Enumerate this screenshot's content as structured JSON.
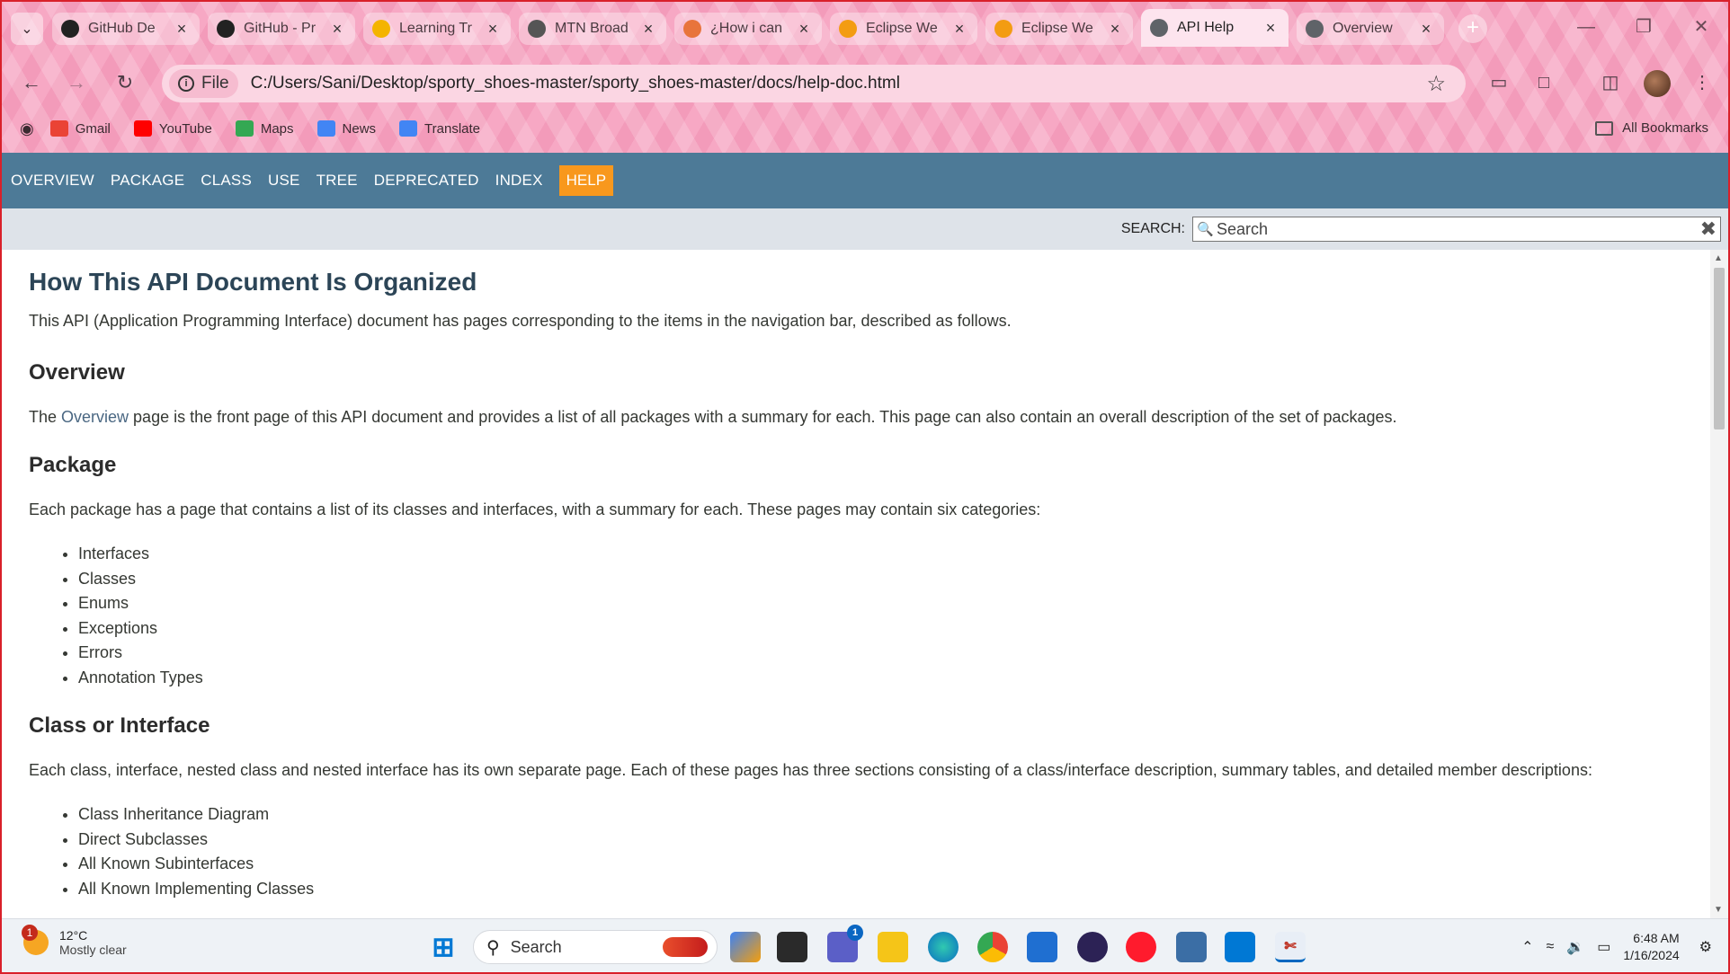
{
  "browser": {
    "tabs": [
      {
        "title": "GitHub De",
        "icon": "github-icon",
        "color": "#222222",
        "active": false
      },
      {
        "title": "GitHub - Pr",
        "icon": "github-icon",
        "color": "#222222",
        "active": false
      },
      {
        "title": "Learning Tr",
        "icon": "analytics-icon",
        "color": "#f4b400",
        "active": false
      },
      {
        "title": "MTN Broad",
        "icon": "mtn-icon",
        "color": "#555555",
        "active": false
      },
      {
        "title": "¿How i can",
        "icon": "pen-icon",
        "color": "#e8743b",
        "active": false
      },
      {
        "title": "Eclipse We",
        "icon": "ef-icon",
        "color": "#f39c12",
        "active": false
      },
      {
        "title": "Eclipse We",
        "icon": "ef-icon",
        "color": "#f39c12",
        "active": false
      },
      {
        "title": "API Help",
        "icon": "globe-icon",
        "color": "#5f6368",
        "active": true
      },
      {
        "title": "Overview",
        "icon": "globe-icon",
        "color": "#5f6368",
        "active": false
      }
    ],
    "address": {
      "scheme_label": "File",
      "url": "C:/Users/Sani/Desktop/sporty_shoes-master/sporty_shoes-master/docs/help-doc.html"
    },
    "bookmarks": [
      {
        "label": "Gmail",
        "color": "#ea4335"
      },
      {
        "label": "YouTube",
        "color": "#ff0000"
      },
      {
        "label": "Maps",
        "color": "#34a853"
      },
      {
        "label": "News",
        "color": "#4285f4"
      },
      {
        "label": "Translate",
        "color": "#4285f4"
      }
    ],
    "all_bookmarks": "All Bookmarks"
  },
  "doc": {
    "nav": [
      "OVERVIEW",
      "PACKAGE",
      "CLASS",
      "USE",
      "TREE",
      "DEPRECATED",
      "INDEX"
    ],
    "nav_current": "HELP",
    "search_label": "SEARCH:",
    "search_placeholder": "Search",
    "title": "How This API Document Is Organized",
    "intro": "This API (Application Programming Interface) document has pages corresponding to the items in the navigation bar, described as follows.",
    "overview_heading": "Overview",
    "overview_prefix": "The ",
    "overview_link": "Overview",
    "overview_text": " page is the front page of this API document and provides a list of all packages with a summary for each. This page can also contain an overall description of the set of packages.",
    "package_heading": "Package",
    "package_text": "Each package has a page that contains a list of its classes and interfaces, with a summary for each. These pages may contain six categories:",
    "package_items": [
      "Interfaces",
      "Classes",
      "Enums",
      "Exceptions",
      "Errors",
      "Annotation Types"
    ],
    "class_heading": "Class or Interface",
    "class_text": "Each class, interface, nested class and nested interface has its own separate page. Each of these pages has three sections consisting of a class/interface description, summary tables, and detailed member descriptions:",
    "class_items": [
      "Class Inheritance Diagram",
      "Direct Subclasses",
      "All Known Subinterfaces",
      "All Known Implementing Classes"
    ]
  },
  "taskbar": {
    "weather_temp": "12°C",
    "weather_desc": "Mostly clear",
    "weather_badge": "1",
    "search_label": "Search",
    "teams_badge": "1",
    "time": "6:48 AM",
    "date": "1/16/2024"
  }
}
